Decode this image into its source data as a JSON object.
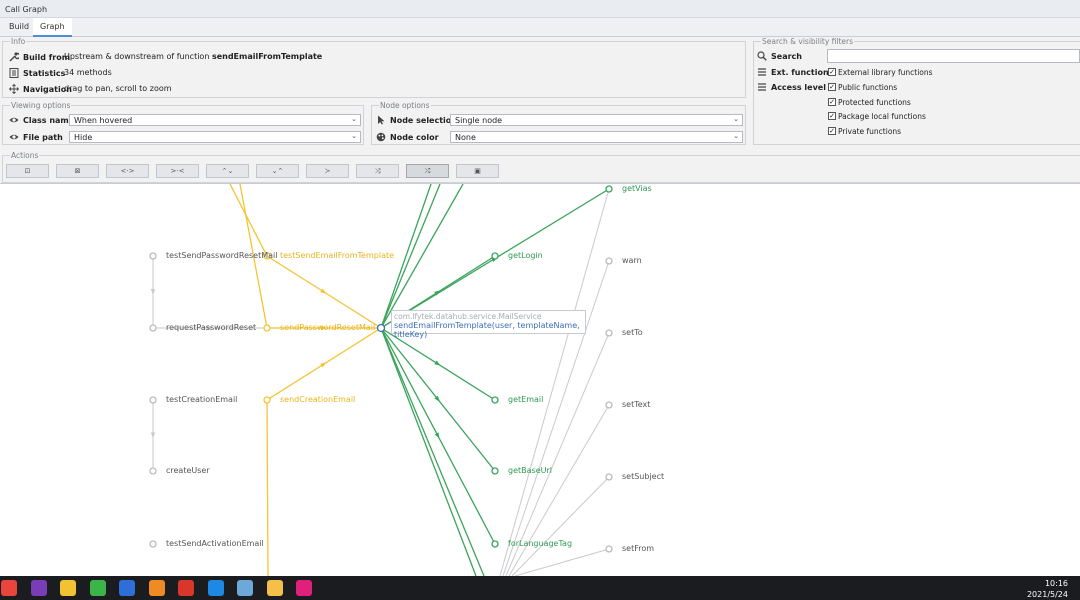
{
  "window": {
    "title": "Call Graph"
  },
  "tabs": [
    {
      "label": "Build"
    },
    {
      "label": "Graph"
    }
  ],
  "info": {
    "legend": "Info",
    "build_from_label": "Build from",
    "build_from_text": "Upstream & downstream of function",
    "build_from_function": "sendEmailFromTemplate",
    "statistics_label": "Statistics",
    "statistics_value": "34 methods",
    "navigation_label": "Navigation",
    "navigation_value": "drag to pan, scroll to zoom"
  },
  "viewing_options": {
    "legend": "Viewing options",
    "class_name_label": "Class name",
    "class_name_value": "When hovered",
    "file_path_label": "File path",
    "file_path_value": "Hide"
  },
  "node_options": {
    "legend": "Node options",
    "node_selection_label": "Node selection",
    "node_selection_value": "Single node",
    "node_color_label": "Node color",
    "node_color_value": "None"
  },
  "filters": {
    "legend": "Search & visibility filters",
    "search_label": "Search",
    "search_value": "",
    "ext_functions_label": "Ext. functions",
    "ext_library_label": "External library functions",
    "ext_library_checked": true,
    "access_level_label": "Access level",
    "public_label": "Public functions",
    "protected_label": "Protected functions",
    "package_local_label": "Package local functions",
    "private_label": "Private functions"
  },
  "actions": {
    "legend": "Actions",
    "buttons": [
      {
        "name": "fit-to-view",
        "glyph": "⊡",
        "active": false
      },
      {
        "name": "fit-best",
        "glyph": "⊠",
        "active": false
      },
      {
        "name": "expand-horizontal",
        "glyph": "<·>",
        "active": false
      },
      {
        "name": "collapse-horizontal",
        "glyph": ">·<",
        "active": false
      },
      {
        "name": "expand-vertical",
        "glyph": "⌃⌄",
        "active": false
      },
      {
        "name": "collapse-vertical",
        "glyph": "⌄⌃",
        "active": false
      },
      {
        "name": "layout-merge",
        "glyph": "≻",
        "active": false
      },
      {
        "name": "layout-split",
        "glyph": "⤨",
        "active": false
      },
      {
        "name": "layout-shuffle",
        "glyph": "⤮",
        "active": true
      },
      {
        "name": "screenshot",
        "glyph": "▣",
        "active": false
      }
    ]
  },
  "graph": {
    "colors": {
      "upstream": "#f4c431",
      "downstream": "#3aa45b",
      "external": "#c8cace",
      "selected": "#3b6fb6"
    },
    "nodes": [
      {
        "id": "testSendPasswordResetMail",
        "label": "testSendPasswordResetMail",
        "kind": "external"
      },
      {
        "id": "testSendEmailFromTemplate",
        "label": "testSendEmailFromTemplate",
        "kind": "upstream"
      },
      {
        "id": "requestPasswordReset",
        "label": "requestPasswordReset",
        "kind": "external"
      },
      {
        "id": "sendPasswordResetMail",
        "label": "sendPasswordResetMail",
        "kind": "upstream"
      },
      {
        "id": "testCreationEmail",
        "label": "testCreationEmail",
        "kind": "external"
      },
      {
        "id": "sendCreationEmail",
        "label": "sendCreationEmail",
        "kind": "upstream"
      },
      {
        "id": "createUser",
        "label": "createUser",
        "kind": "external"
      },
      {
        "id": "testSendActivationEmail",
        "label": "testSendActivationEmail",
        "kind": "external"
      },
      {
        "id": "getLogin",
        "label": "getLogin",
        "kind": "downstream"
      },
      {
        "id": "getEmail",
        "label": "getEmail",
        "kind": "downstream"
      },
      {
        "id": "getBaseUrl",
        "label": "getBaseUrl",
        "kind": "downstream"
      },
      {
        "id": "forLanguageTag",
        "label": "forLanguageTag",
        "kind": "downstream"
      },
      {
        "id": "getVias",
        "label": "getVias",
        "kind": "downstream"
      },
      {
        "id": "warn",
        "label": "warn",
        "kind": "external"
      },
      {
        "id": "setTo",
        "label": "setTo",
        "kind": "external"
      },
      {
        "id": "setText",
        "label": "setText",
        "kind": "external"
      },
      {
        "id": "setSubject",
        "label": "setSubject",
        "kind": "external"
      },
      {
        "id": "setFrom",
        "label": "setFrom",
        "kind": "external"
      },
      {
        "id": "sendEmailFromTemplate",
        "label": "",
        "kind": "selected"
      }
    ],
    "edges": [
      [
        "testSendPasswordResetMail",
        "requestPasswordReset",
        "external"
      ],
      [
        "testCreationEmail",
        "createUser",
        "external"
      ],
      [
        "requestPasswordReset",
        "sendPasswordResetMail",
        "external"
      ],
      [
        "testSendEmailFromTemplate",
        "sendEmailFromTemplate",
        "upstream"
      ],
      [
        "sendPasswordResetMail",
        "sendEmailFromTemplate",
        "upstream"
      ],
      [
        "sendCreationEmail",
        "sendEmailFromTemplate",
        "upstream"
      ],
      [
        "sendEmailFromTemplate",
        "getLogin",
        "downstream"
      ],
      [
        "sendEmailFromTemplate",
        "getEmail",
        "downstream"
      ],
      [
        "sendEmailFromTemplate",
        "getBaseUrl",
        "downstream"
      ],
      [
        "sendEmailFromTemplate",
        "forLanguageTag",
        "downstream"
      ],
      [
        "sendEmailFromTemplate",
        "getVias",
        "downstream"
      ]
    ],
    "tooltip": {
      "class_name": "com.lfytek.datahub.service.MailService",
      "signature": "sendEmailFromTemplate(user, templateName, titleKey)"
    }
  },
  "taskbar": {
    "icons": [
      "chrome",
      "onenote",
      "explorer",
      "wechat",
      "typora",
      "sublime",
      "gitkraken",
      "edge",
      "notepad",
      "folder",
      "intellij"
    ],
    "time": "10:16",
    "date": "2021/5/24"
  }
}
